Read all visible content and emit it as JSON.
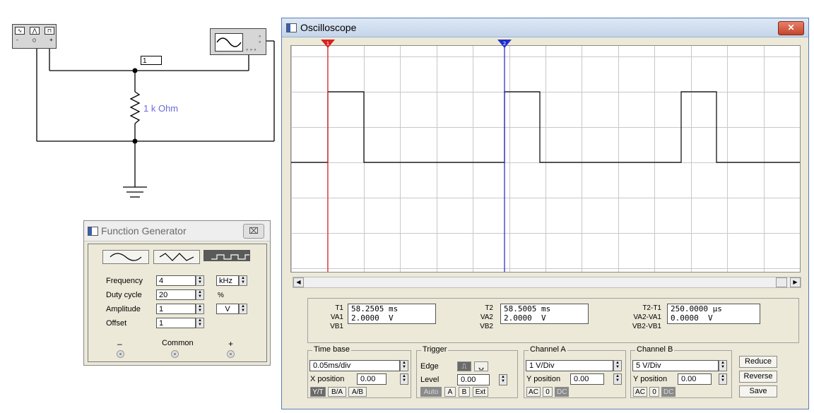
{
  "schematic": {
    "node_label": "1",
    "resistor_label": "1 k Ohm",
    "fg_terminals": {
      "minus": "-",
      "common": "○",
      "plus": "+"
    }
  },
  "function_generator": {
    "title": "Function Generator",
    "close_label": "⌧",
    "waveforms": [
      "sine",
      "triangle",
      "square"
    ],
    "selected_waveform": "square",
    "fields": [
      {
        "label": "Frequency",
        "value": "4",
        "unit": "kHz"
      },
      {
        "label": "Duty cycle",
        "value": "20",
        "unit": "%"
      },
      {
        "label": "Amplitude",
        "value": "1",
        "unit": "V"
      },
      {
        "label": "Offset",
        "value": "1",
        "unit": ""
      }
    ],
    "terminals": {
      "minus": "–",
      "common": "Common",
      "plus": "+"
    }
  },
  "oscilloscope": {
    "title": "Oscilloscope",
    "close_label": "✕",
    "cursor1_label": "1",
    "cursor2_label": "2",
    "measurements": {
      "t1_label": "T1",
      "va1_label": "VA1",
      "vb1_label": "VB1",
      "t1_value": "58.2505 ms",
      "va1_value": "2.0000  V",
      "vb1_value": "",
      "t2_label": "T2",
      "va2_label": "VA2",
      "vb2_label": "VB2",
      "t2_value": "58.5005 ms",
      "va2_value": "2.0000  V",
      "vb2_value": "",
      "dt_label": "T2-T1",
      "dva_label": "VA2-VA1",
      "dvb_label": "VB2-VB1",
      "dt_value": "250.0000 µs",
      "dva_value": "0.0000  V",
      "dvb_value": ""
    },
    "timebase": {
      "title": "Time base",
      "scale": "0.05ms/div",
      "xpos_label": "X position",
      "xpos_value": "0.00",
      "buttons": [
        "Y/T",
        "B/A",
        "A/B"
      ],
      "active_button": "Y/T"
    },
    "trigger": {
      "title": "Trigger",
      "edge_label": "Edge",
      "level_label": "Level",
      "level_value": "0.00",
      "buttons": [
        "Auto",
        "A",
        "B",
        "Ext"
      ]
    },
    "channel_a": {
      "title": "Channel A",
      "scale": "1 V/Div",
      "ypos_label": "Y position",
      "ypos_value": "0.00",
      "buttons": [
        "AC",
        "0",
        "DC"
      ]
    },
    "channel_b": {
      "title": "Channel B",
      "scale": "5 V/Div",
      "ypos_label": "Y position",
      "ypos_value": "0.00",
      "buttons": [
        "AC",
        "0",
        "DC"
      ]
    },
    "actions": {
      "reduce": "Reduce",
      "reverse": "Reverse",
      "save": "Save"
    },
    "colors": {
      "trace": "#000000",
      "cursor1": "#e02020",
      "cursor2": "#2020d0",
      "grid": "#c8c8c8"
    }
  }
}
